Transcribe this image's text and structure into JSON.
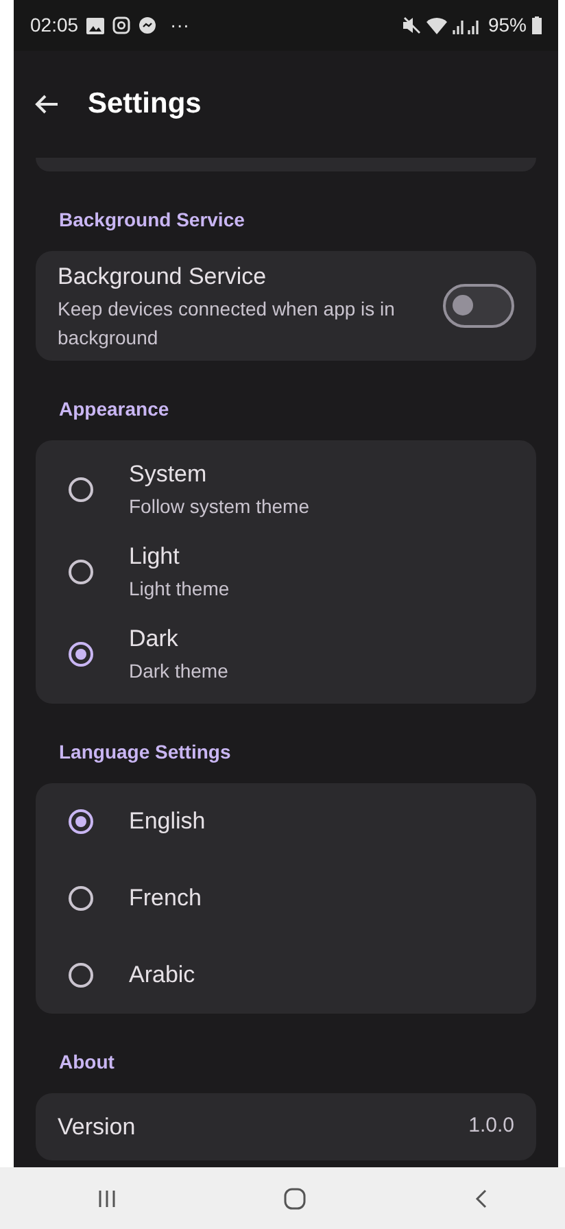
{
  "status_bar": {
    "time": "02:05",
    "more": "···",
    "battery": "95%"
  },
  "app_bar": {
    "title": "Settings"
  },
  "sections": [
    {
      "title": "Background Service",
      "kind": "switch",
      "items": [
        {
          "title": "Background Service",
          "subtitle": "Keep devices connected when app is in background",
          "on": false
        }
      ]
    },
    {
      "title": "Appearance",
      "kind": "radio",
      "items": [
        {
          "title": "System",
          "subtitle": "Follow system theme",
          "selected": false
        },
        {
          "title": "Light",
          "subtitle": "Light theme",
          "selected": false
        },
        {
          "title": "Dark",
          "subtitle": "Dark theme",
          "selected": true
        }
      ]
    },
    {
      "title": "Language Settings",
      "kind": "radio",
      "items": [
        {
          "title": "English",
          "selected": true
        },
        {
          "title": "French",
          "selected": false
        },
        {
          "title": "Arabic",
          "selected": false
        }
      ]
    },
    {
      "title": "About",
      "kind": "info",
      "items": [
        {
          "title": "Version",
          "value": "1.0.0"
        }
      ]
    }
  ]
}
